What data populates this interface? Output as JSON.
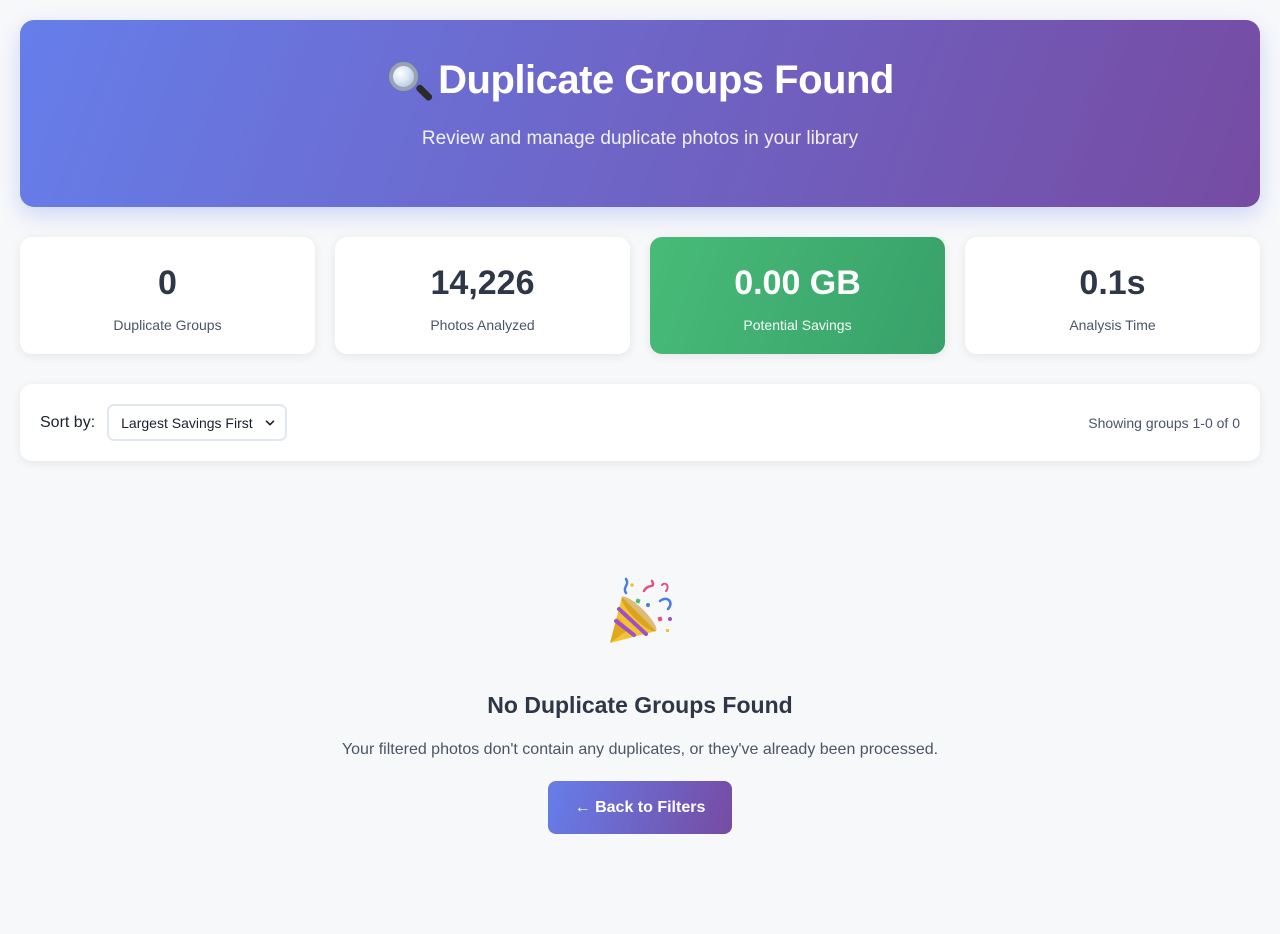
{
  "header": {
    "icon": "magnifier-icon",
    "title": "Duplicate Groups Found",
    "subtitle": "Review and manage duplicate photos in your library"
  },
  "stats": [
    {
      "value": "0",
      "label": "Duplicate Groups"
    },
    {
      "value": "14,226",
      "label": "Photos Analyzed"
    },
    {
      "value": "0.00 GB",
      "label": "Potential Savings"
    },
    {
      "value": "0.1s",
      "label": "Analysis Time"
    }
  ],
  "toolbar": {
    "sort_label": "Sort by:",
    "sort_selected": "Largest Savings First",
    "showing_text": "Showing groups 1-0 of 0"
  },
  "empty_state": {
    "icon": "party-popper-icon",
    "title": "No Duplicate Groups Found",
    "message": "Your filtered photos don't contain any duplicates, or they've already been processed.",
    "button_label": "← Back to Filters"
  },
  "colors": {
    "accent_start": "#667eea",
    "accent_end": "#764ba2",
    "savings_green": "#48bb78",
    "background": "#f7f8fa"
  }
}
